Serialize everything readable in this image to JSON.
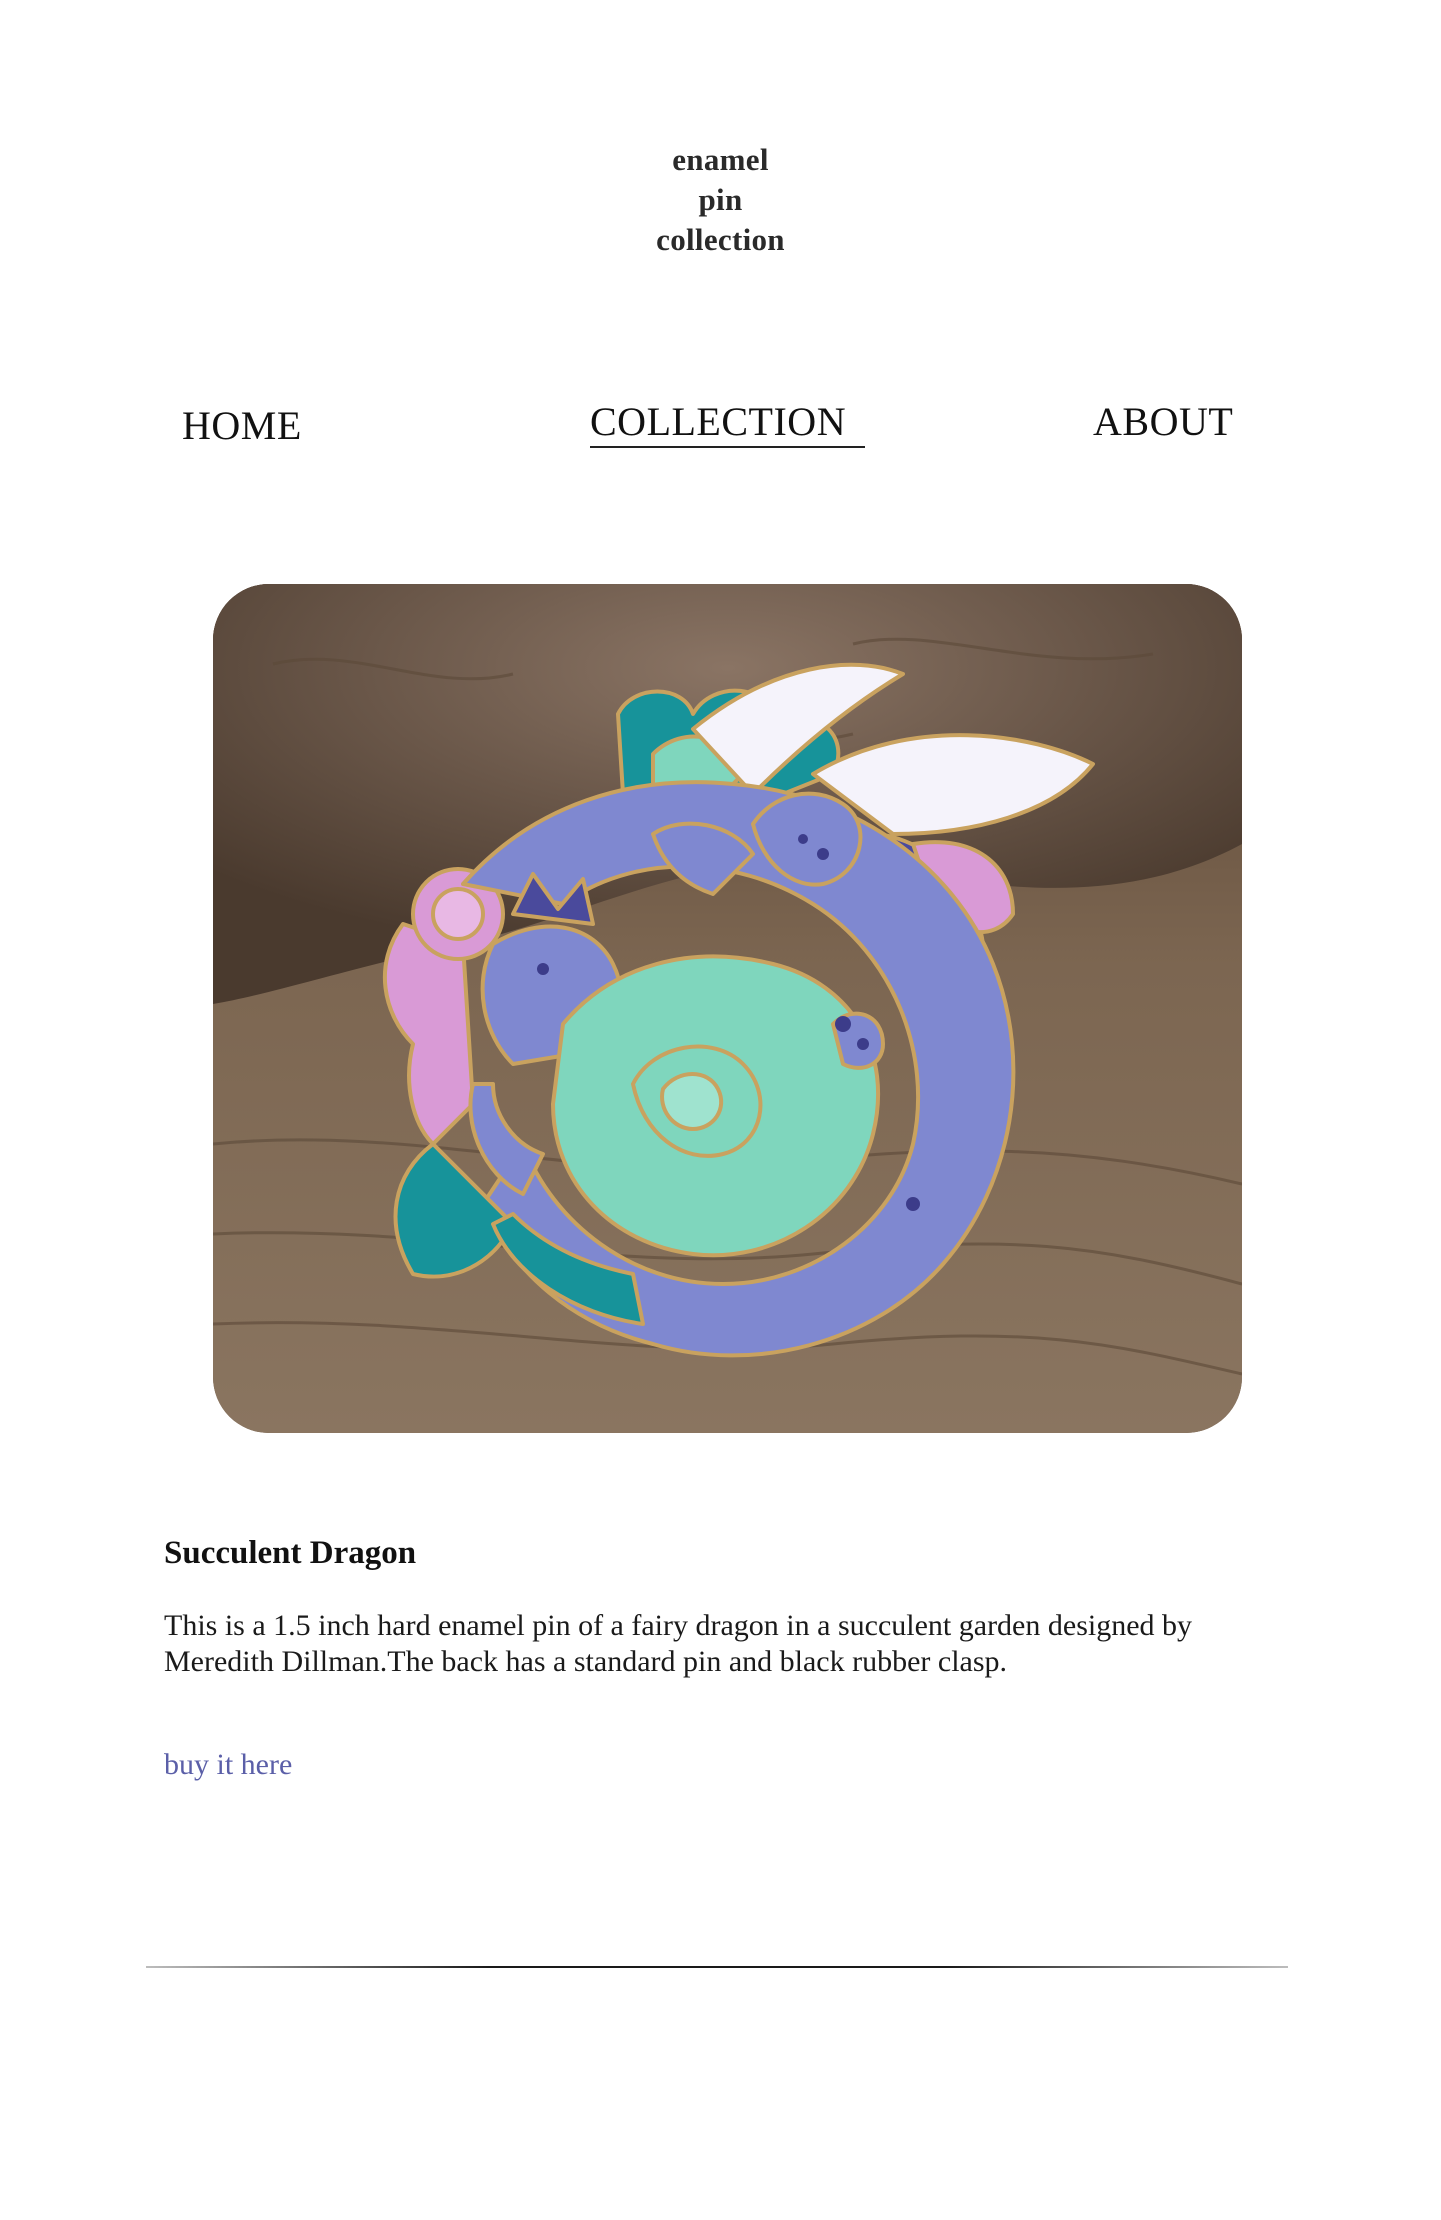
{
  "site": {
    "title_lines": [
      "enamel",
      "pin",
      "collection"
    ]
  },
  "nav": {
    "items": [
      {
        "label": "HOME",
        "active": false
      },
      {
        "label": "COLLECTION",
        "active": true
      },
      {
        "label": "ABOUT",
        "active": false
      }
    ]
  },
  "product": {
    "name": "Succulent Dragon",
    "description": "This is a 1.5 inch hard enamel pin of a fairy dragon in a succulent garden designed by Meredith Dillman.The back has a standard pin and black rubber clasp.",
    "buy_label": "buy it here",
    "image_subject": "enamel pin of a periwinkle fairy dragon curled around mint and teal succulents with pink flowers and white wings, on a wood-and-bark background"
  },
  "colors": {
    "link": "#5b5fa8",
    "dragon": "#7f88d0",
    "succulent_mint": "#7fd6bd",
    "succulent_teal": "#17939a",
    "flower_pink": "#d99ad6",
    "wing": "#f5f3fb",
    "gold_outline": "#c9a25f",
    "wood": "#7b6550"
  }
}
